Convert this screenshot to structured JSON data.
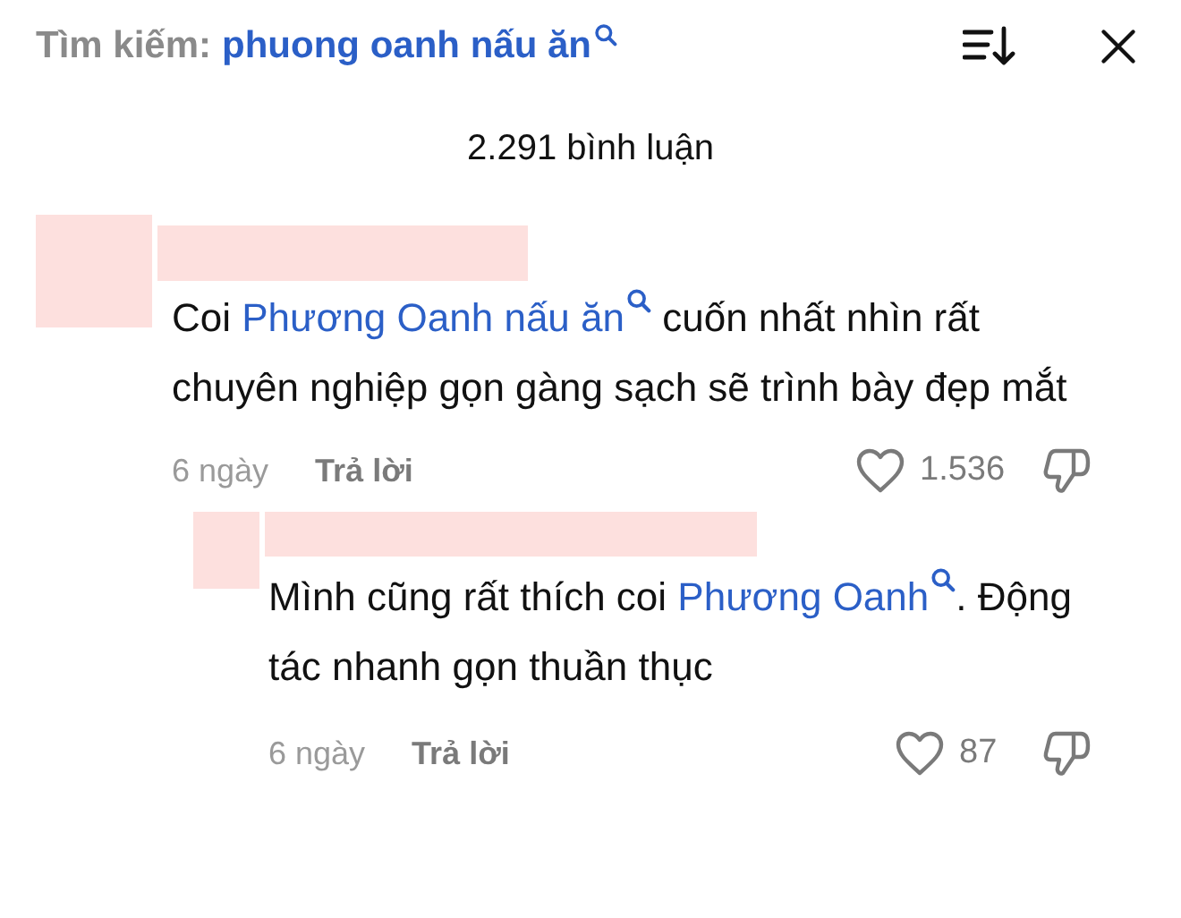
{
  "search": {
    "label": "Tìm kiếm:",
    "query": "phuong oanh nấu ăn"
  },
  "comment_count": "2.291 bình luận",
  "comments": [
    {
      "body": [
        {
          "kind": "text",
          "text": "Coi "
        },
        {
          "kind": "link",
          "text": "Phương Oanh nấu ăn"
        },
        {
          "kind": "text",
          "text": " cuốn nhất nhìn rất chuyên nghiệp gọn gàng sạch sẽ trình bày đẹp mắt"
        }
      ],
      "time": "6 ngày",
      "reply": "Trả lời",
      "likes": "1.536",
      "replies": [
        {
          "body": [
            {
              "kind": "text",
              "text": "Mình cũng rất thích coi "
            },
            {
              "kind": "link",
              "text": "Phương Oanh"
            },
            {
              "kind": "text",
              "text": ". Động tác nhanh gọn thuần thục"
            }
          ],
          "time": "6 ngày",
          "reply": "Trả lời",
          "likes": "87"
        }
      ]
    }
  ]
}
